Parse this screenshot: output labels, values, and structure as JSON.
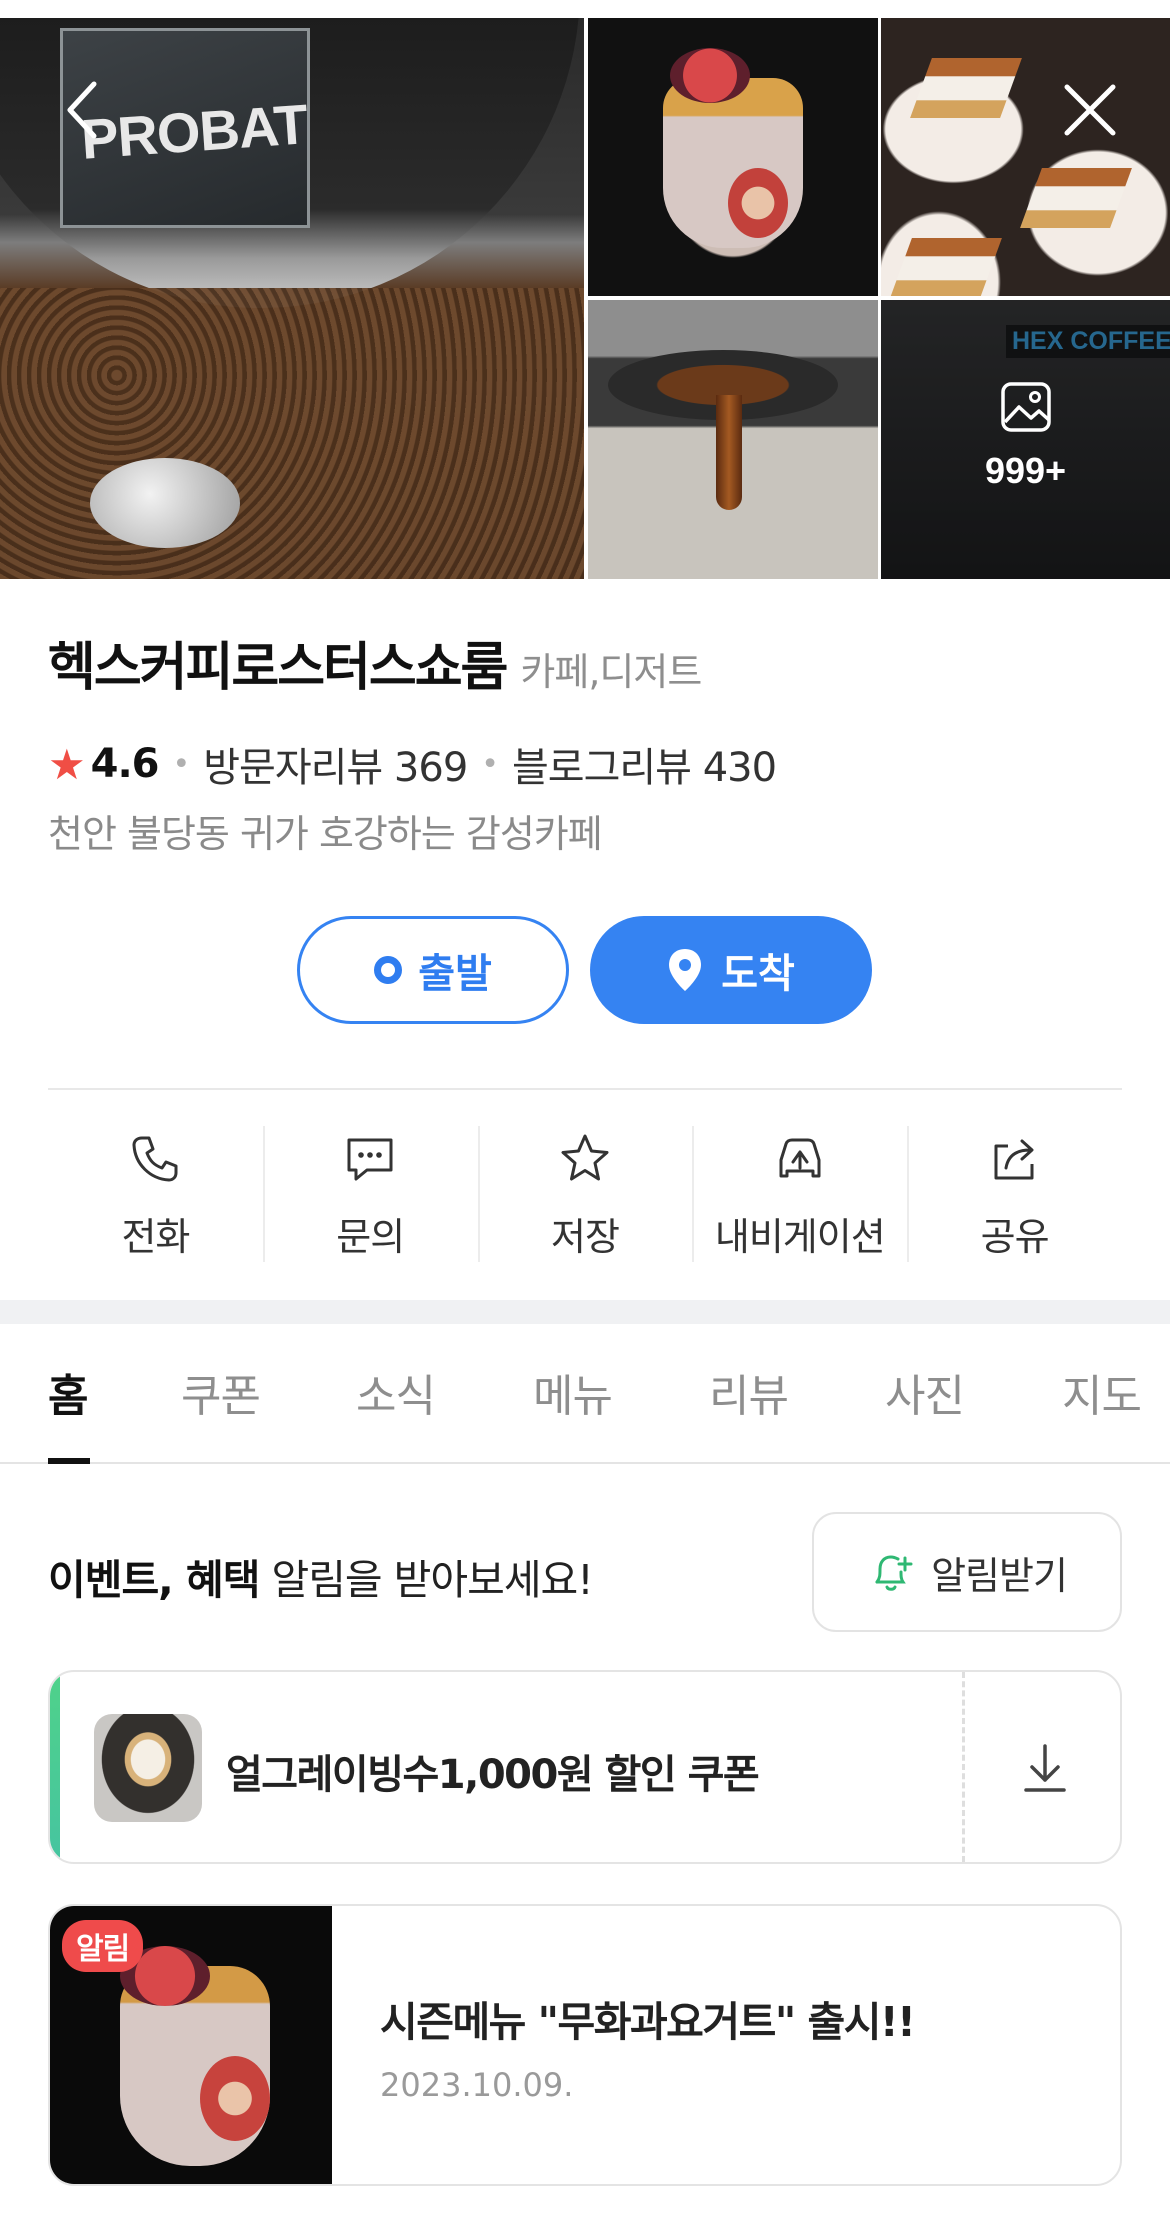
{
  "gallery": {
    "roaster_brand": "PROBAT",
    "cafe_sign": "HEX COFFEE",
    "more_photos_count": "999+"
  },
  "place": {
    "name": "헥스커피로스터스쇼룸",
    "category": "카페,디저트",
    "rating": "4.6",
    "visitor_reviews_label": "방문자리뷰 369",
    "blog_reviews_label": "블로그리뷰 430",
    "description": "천안 불당동 귀가 호강하는 감성카페"
  },
  "route": {
    "depart_label": "출발",
    "arrive_label": "도착"
  },
  "actions": [
    {
      "label": "전화",
      "icon": "phone-icon"
    },
    {
      "label": "문의",
      "icon": "chat-icon"
    },
    {
      "label": "저장",
      "icon": "star-icon"
    },
    {
      "label": "내비게이션",
      "icon": "car-navigation-icon"
    },
    {
      "label": "공유",
      "icon": "share-icon"
    }
  ],
  "tabs": [
    {
      "label": "홈"
    },
    {
      "label": "쿠폰"
    },
    {
      "label": "소식"
    },
    {
      "label": "메뉴"
    },
    {
      "label": "리뷰"
    },
    {
      "label": "사진"
    },
    {
      "label": "지도"
    }
  ],
  "notice": {
    "bold_text": "이벤트, 혜택",
    "text": " 알림을 받아보세요!",
    "button_label": "알림받기"
  },
  "coupon": {
    "title": "얼그레이빙수1,000원 할인 쿠폰"
  },
  "news": {
    "badge": "알림",
    "title": "시즌메뉴 \"무화과요거트\" 출시!!",
    "date": "2023.10.09."
  },
  "colors": {
    "accent_blue": "#3583f2",
    "rating_star": "#f04e45",
    "coupon_green": "#4fd28a",
    "badge_red": "#ef4b4b"
  }
}
